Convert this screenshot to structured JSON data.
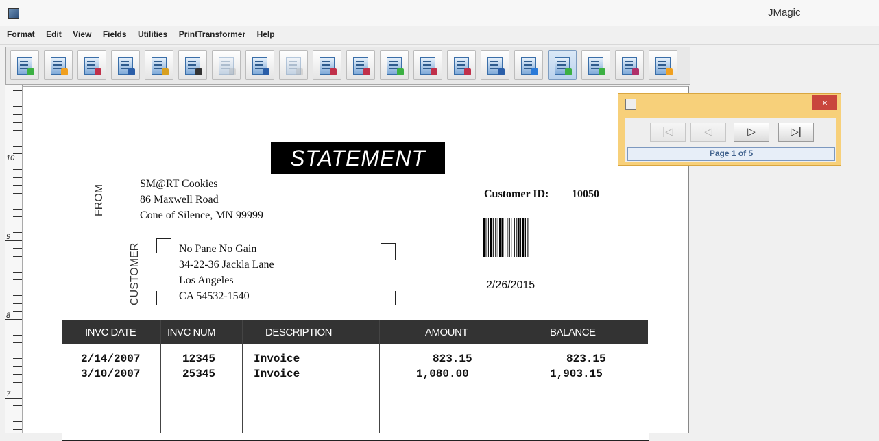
{
  "window": {
    "title": "JMagic"
  },
  "menu": [
    "Format",
    "Edit",
    "View",
    "Fields",
    "Utilities",
    "PrintTransformer",
    "Help"
  ],
  "toolbar": {
    "buttons": [
      {
        "name": "new-form-button",
        "icon": "new-document-icon",
        "accent": "#3cb043"
      },
      {
        "name": "open-button",
        "icon": "open-folder-icon",
        "accent": "#f0a020"
      },
      {
        "name": "save-button",
        "icon": "save-icon",
        "accent": "#c0304a"
      },
      {
        "name": "print-button",
        "icon": "printer-icon",
        "accent": "#2a5ea8"
      },
      {
        "name": "database-button",
        "icon": "database-icon",
        "accent": "#d8a020"
      },
      {
        "name": "barcode-field-button",
        "icon": "barcode-icon",
        "accent": "#333333"
      },
      {
        "name": "disabled-tool-1",
        "icon": "box-icon",
        "accent": "#aaaaaa",
        "disabled": true
      },
      {
        "name": "text-field-button",
        "icon": "abc-text-icon",
        "accent": "#2a5ea8"
      },
      {
        "name": "disabled-tool-2",
        "icon": "box-icon",
        "accent": "#aaaaaa",
        "disabled": true
      },
      {
        "name": "rectangle-button",
        "icon": "rectangle-icon",
        "accent": "#c0304a"
      },
      {
        "name": "line-button",
        "icon": "line-icon",
        "accent": "#c0304a"
      },
      {
        "name": "new-image-button",
        "icon": "image-icon",
        "accent": "#3cb043"
      },
      {
        "name": "align-button",
        "icon": "align-icon",
        "accent": "#c0304a"
      },
      {
        "name": "attach-button",
        "icon": "attachment-icon",
        "accent": "#c0304a"
      },
      {
        "name": "list-button",
        "icon": "list-icon",
        "accent": "#2a5ea8"
      },
      {
        "name": "grid-button",
        "icon": "grid-icon",
        "accent": "#2a7ad8"
      },
      {
        "name": "preview-button",
        "icon": "magnifier-icon",
        "accent": "#3cb043",
        "active": true
      },
      {
        "name": "select-button",
        "icon": "cursor-icon",
        "accent": "#3cb043"
      },
      {
        "name": "undo-button",
        "icon": "undo-arrow-icon",
        "accent": "#b0306a"
      },
      {
        "name": "redo-button",
        "icon": "redo-arrow-icon",
        "accent": "#f0a020"
      }
    ]
  },
  "ruler": {
    "marks": [
      "10",
      "9",
      "8",
      "7"
    ]
  },
  "document": {
    "title": "STATEMENT",
    "from_label": "FROM",
    "from_lines": [
      "SM@RT Cookies",
      "86 Maxwell Road",
      "Cone of Silence, MN 99999"
    ],
    "customer_label": "CUSTOMER",
    "customer_lines": [
      "No Pane No Gain",
      "34-22-36 Jackla Lane",
      "Los Angeles",
      "CA  54532-1540"
    ],
    "customer_id_label": "Customer ID:",
    "customer_id_value": "10050",
    "date": "2/26/2015",
    "table": {
      "headers": [
        "INVC DATE",
        "INVC NUM",
        "DESCRIPTION",
        "AMOUNT",
        "BALANCE"
      ],
      "rows": [
        [
          "2/14/2007",
          "12345",
          "Invoice",
          "823.15",
          "823.15"
        ],
        [
          "3/10/2007",
          "25345",
          "Invoice",
          "1,080.00",
          "1,903.15"
        ]
      ]
    }
  },
  "pager": {
    "close_label": "×",
    "buttons": [
      {
        "name": "first-page-button",
        "label": "|◁",
        "disabled": true
      },
      {
        "name": "prev-page-button",
        "label": "◁",
        "disabled": true
      },
      {
        "name": "next-page-button",
        "label": "▷",
        "disabled": false
      },
      {
        "name": "last-page-button",
        "label": "▷|",
        "disabled": false
      }
    ],
    "page_text": "Page 1 of 5"
  }
}
